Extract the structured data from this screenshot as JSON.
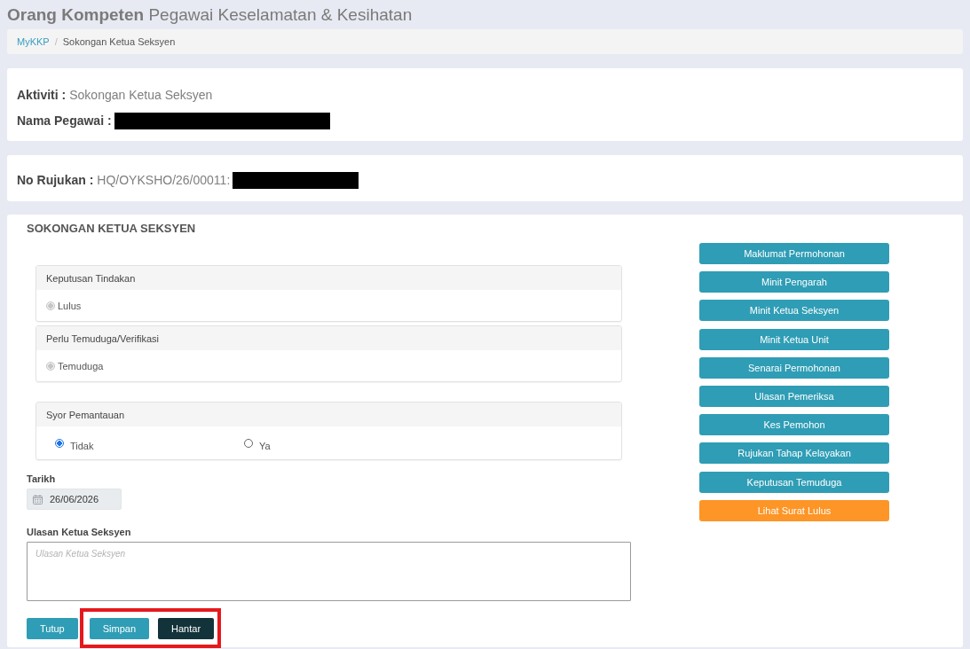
{
  "page_title": "**Orang Kompeten** Pegawai Keselamatan & Kesihatan",
  "breadcrumb": {
    "items": [
      {
        "label": "MyKKP",
        "kind": "link"
      },
      {
        "label": "Sokongan Ketua Seksyen",
        "kind": "current"
      }
    ],
    "separator": "/"
  },
  "summary": {
    "fields": [
      {
        "label": "Aktiviti :",
        "value": "Sokongan Ketua Seksyen"
      },
      {
        "label": "Nama Pegawai :",
        "redacted": true
      }
    ]
  },
  "reference": {
    "label": "No Rujukan :",
    "value": "HQ/OYKSHO/26/00011:",
    "redacted": true
  },
  "form": {
    "title": "SOKONGAN KETUA SEKSYEN",
    "decision_panels": [
      {
        "title": "Keputusan Tindakan",
        "options": [
          {
            "label": "Lulus",
            "selected": true,
            "disabled": true
          }
        ]
      },
      {
        "title": "Perlu Temuduga/Verifikasi",
        "options": [
          {
            "label": "Temuduga",
            "selected": true,
            "disabled": true
          }
        ]
      }
    ],
    "recommendation_panel": {
      "title": "Syor Pemantauan",
      "options": [
        {
          "label": "Tidak",
          "selected": true,
          "disabled": false
        },
        {
          "label": "Ya",
          "selected": false,
          "disabled": false
        }
      ]
    },
    "date": {
      "label": "Tarikh",
      "value": "26/06/2026",
      "disabled": true
    },
    "comment": {
      "label": "Ulasan Ketua Seksyen",
      "placeholder": "Ulasan Ketua Seksyen"
    },
    "actions": [
      {
        "label": "Tutup",
        "kind": "primary",
        "highlighted": false
      },
      {
        "label": "Simpan",
        "kind": "primary",
        "highlighted": true
      },
      {
        "label": "Hantar",
        "kind": "dark",
        "highlighted": true
      }
    ]
  },
  "side_buttons": [
    {
      "label": "Maklumat Permohonan",
      "kind": "info"
    },
    {
      "label": "Minit Pengarah",
      "kind": "info"
    },
    {
      "label": "Minit Ketua Seksyen",
      "kind": "info"
    },
    {
      "label": "Minit Ketua Unit",
      "kind": "info"
    },
    {
      "label": "Senarai Permohonan",
      "kind": "info"
    },
    {
      "label": "Ulasan Pemeriksa",
      "kind": "info"
    },
    {
      "label": "Kes Pemohon",
      "kind": "info"
    },
    {
      "label": "Rujukan Tahap Kelayakan",
      "kind": "info"
    },
    {
      "label": "Keputusan Temuduga",
      "kind": "info"
    },
    {
      "label": "Lihat Surat Lulus",
      "kind": "warning"
    }
  ]
}
